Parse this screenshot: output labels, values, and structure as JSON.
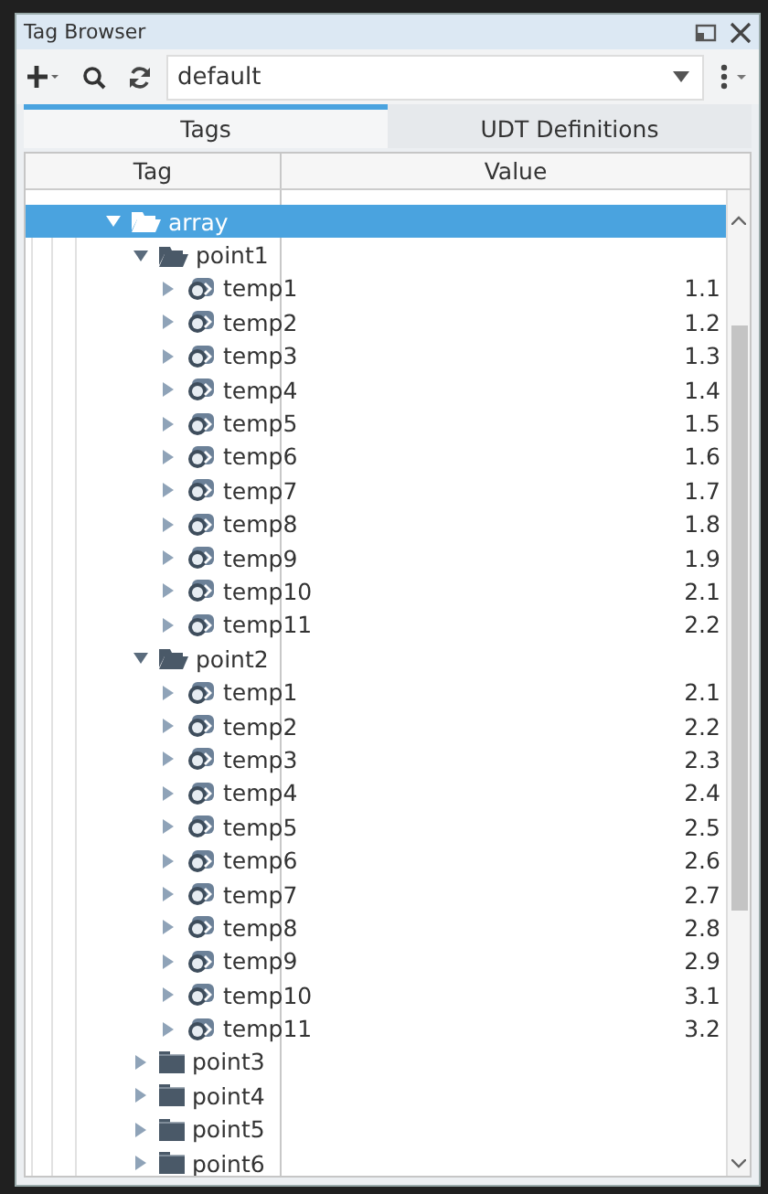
{
  "window": {
    "title": "Tag Browser"
  },
  "toolbar": {
    "provider": "default"
  },
  "tabs": [
    {
      "label": "Tags",
      "selected": true
    },
    {
      "label": "UDT Definitions",
      "selected": false
    }
  ],
  "table": {
    "columns": [
      "Tag",
      "Value"
    ]
  },
  "tree": [
    {
      "label": "array",
      "kind": "folder",
      "expanded": true,
      "selected": true,
      "children": [
        {
          "label": "point1",
          "kind": "folder",
          "expanded": true,
          "selected": false,
          "children": [
            {
              "label": "temp1",
              "kind": "udt",
              "expanded": false,
              "selected": false,
              "value": "1.1"
            },
            {
              "label": "temp2",
              "kind": "udt",
              "expanded": false,
              "selected": false,
              "value": "1.2"
            },
            {
              "label": "temp3",
              "kind": "udt",
              "expanded": false,
              "selected": false,
              "value": "1.3"
            },
            {
              "label": "temp4",
              "kind": "udt",
              "expanded": false,
              "selected": false,
              "value": "1.4"
            },
            {
              "label": "temp5",
              "kind": "udt",
              "expanded": false,
              "selected": false,
              "value": "1.5"
            },
            {
              "label": "temp6",
              "kind": "udt",
              "expanded": false,
              "selected": false,
              "value": "1.6"
            },
            {
              "label": "temp7",
              "kind": "udt",
              "expanded": false,
              "selected": false,
              "value": "1.7"
            },
            {
              "label": "temp8",
              "kind": "udt",
              "expanded": false,
              "selected": false,
              "value": "1.8"
            },
            {
              "label": "temp9",
              "kind": "udt",
              "expanded": false,
              "selected": false,
              "value": "1.9"
            },
            {
              "label": "temp10",
              "kind": "udt",
              "expanded": false,
              "selected": false,
              "value": "2.1"
            },
            {
              "label": "temp11",
              "kind": "udt",
              "expanded": false,
              "selected": false,
              "value": "2.2"
            }
          ]
        },
        {
          "label": "point2",
          "kind": "folder",
          "expanded": true,
          "selected": false,
          "children": [
            {
              "label": "temp1",
              "kind": "udt",
              "expanded": false,
              "selected": false,
              "value": "2.1"
            },
            {
              "label": "temp2",
              "kind": "udt",
              "expanded": false,
              "selected": false,
              "value": "2.2"
            },
            {
              "label": "temp3",
              "kind": "udt",
              "expanded": false,
              "selected": false,
              "value": "2.3"
            },
            {
              "label": "temp4",
              "kind": "udt",
              "expanded": false,
              "selected": false,
              "value": "2.4"
            },
            {
              "label": "temp5",
              "kind": "udt",
              "expanded": false,
              "selected": false,
              "value": "2.5"
            },
            {
              "label": "temp6",
              "kind": "udt",
              "expanded": false,
              "selected": false,
              "value": "2.6"
            },
            {
              "label": "temp7",
              "kind": "udt",
              "expanded": false,
              "selected": false,
              "value": "2.7"
            },
            {
              "label": "temp8",
              "kind": "udt",
              "expanded": false,
              "selected": false,
              "value": "2.8"
            },
            {
              "label": "temp9",
              "kind": "udt",
              "expanded": false,
              "selected": false,
              "value": "2.9"
            },
            {
              "label": "temp10",
              "kind": "udt",
              "expanded": false,
              "selected": false,
              "value": "3.1"
            },
            {
              "label": "temp11",
              "kind": "udt",
              "expanded": false,
              "selected": false,
              "value": "3.2"
            }
          ]
        },
        {
          "label": "point3",
          "kind": "folder",
          "expanded": false,
          "selected": false
        },
        {
          "label": "point4",
          "kind": "folder",
          "expanded": false,
          "selected": false
        },
        {
          "label": "point5",
          "kind": "folder",
          "expanded": false,
          "selected": false
        },
        {
          "label": "point6",
          "kind": "folder",
          "expanded": false,
          "selected": false
        }
      ]
    }
  ]
}
